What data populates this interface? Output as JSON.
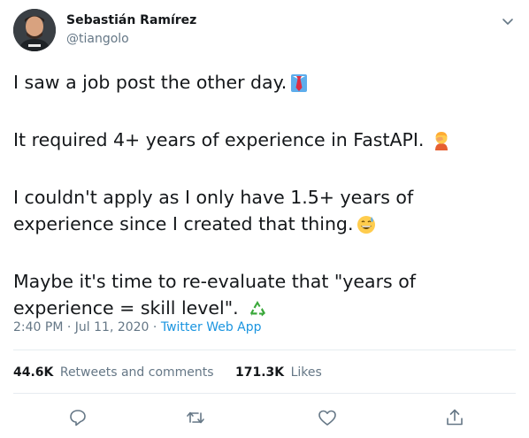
{
  "author": {
    "name": "Sebastián Ramírez",
    "handle": "@tiangolo"
  },
  "tweet": {
    "paragraphs": [
      {
        "text": "I saw a job post the other day.",
        "emoji": "necktie-emoji"
      },
      {
        "text": "It required 4+ years of experience in FastAPI.",
        "emoji": "person-facepalming-emoji"
      },
      {
        "text": "I couldn't apply as I only have 1.5+ years of experience since I created that thing.",
        "emoji": "grinning-sweat-emoji"
      },
      {
        "text": "Maybe it's time to re-evaluate that \"years of experience = skill level\".",
        "emoji": "recycling-symbol-emoji"
      }
    ],
    "time": "2:40 PM",
    "date": "Jul 11, 2020",
    "separator": "·",
    "source": "Twitter Web App"
  },
  "stats": {
    "retweets_count": "44.6K",
    "retweets_label": "Retweets and comments",
    "likes_count": "171.3K",
    "likes_label": "Likes"
  },
  "actions": [
    "reply-icon",
    "retweet-icon",
    "like-icon",
    "share-icon"
  ],
  "colors": {
    "text": "#14171a",
    "secondary": "#657786",
    "link": "#1b95e0",
    "divider": "#e6ecf0",
    "icon": "#657786",
    "recycle_green": "#3aa83a"
  }
}
